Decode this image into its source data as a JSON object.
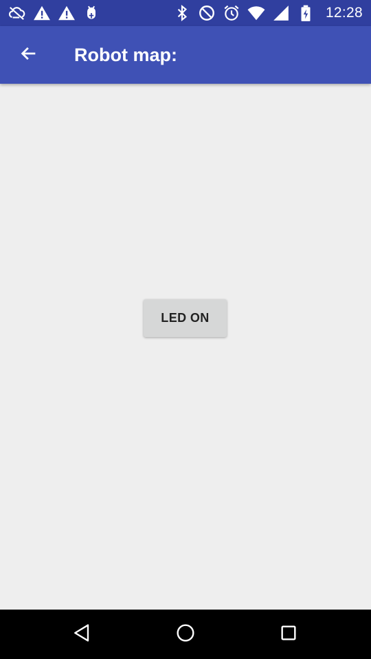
{
  "status_bar": {
    "time": "12:28",
    "left_icons": [
      "cloud-off-icon",
      "warning-icon",
      "warning-icon",
      "android-debug-icon"
    ],
    "right_icons": [
      "bluetooth-icon",
      "do-not-disturb-icon",
      "alarm-icon",
      "wifi-icon",
      "battery-charging-icon",
      "signal-icon"
    ]
  },
  "app_bar": {
    "title": "Robot map:",
    "back_icon": "arrow-back-icon",
    "color": "#3f51b5",
    "status_color": "#303f9f"
  },
  "main": {
    "button_label": "LED ON",
    "background": "#eeeeee"
  },
  "nav_bar": {
    "icons": [
      "back-triangle-icon",
      "home-circle-icon",
      "recents-square-icon"
    ]
  }
}
